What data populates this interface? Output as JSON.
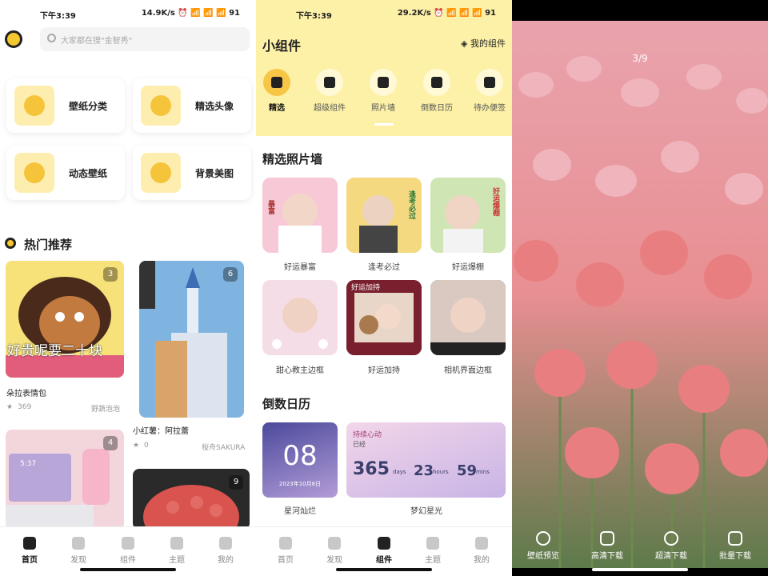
{
  "screen1": {
    "status": {
      "time": "下午3:39",
      "net": "14.9K/s ⏰ 📶 📶 📶 91"
    },
    "search_placeholder": "大家都在搜\"金智秀\"",
    "categories": [
      {
        "label": "壁纸分类"
      },
      {
        "label": "精选头像"
      },
      {
        "label": "动态壁纸"
      },
      {
        "label": "背景美图"
      }
    ],
    "section_title": "热门推荐",
    "cards": [
      {
        "count": "3",
        "overlay_text": "好贵呢要二十块",
        "title": "朵拉表情包",
        "likes": "369",
        "author": "野蔬泡泡"
      },
      {
        "count": "6",
        "title": "小红薯：阿拉蕾",
        "likes": "0",
        "author": "桜舟SAKURA"
      },
      {
        "count": "4",
        "clock": "5:37"
      },
      {
        "count": "9"
      }
    ],
    "nav": [
      "首页",
      "发现",
      "组件",
      "主题",
      "我的"
    ]
  },
  "screen2": {
    "status": {
      "time": "下午3:39",
      "net": "29.2K/s ⏰ 📶 📶 📶 91"
    },
    "title": "小组件",
    "my_widgets": "我的组件",
    "tabs": [
      {
        "label": "精选"
      },
      {
        "label": "超级组件"
      },
      {
        "label": "照片墙"
      },
      {
        "label": "倒数日历"
      },
      {
        "label": "待办便签"
      }
    ],
    "photo_wall_title": "精选照片墙",
    "photo_walls": [
      {
        "label": "好运暴富",
        "tag": "暴富"
      },
      {
        "label": "逢考必过",
        "tag": "逢考必过"
      },
      {
        "label": "好运爆棚",
        "tag": "好运爆棚"
      },
      {
        "label": "甜心教主边框"
      },
      {
        "label": "好运加持",
        "tag": "好运加持"
      },
      {
        "label": "相机界面边框"
      }
    ],
    "countdown_title": "倒数日历",
    "countdowns": [
      {
        "label": "星河灿烂",
        "big": "08",
        "date": "2023年10月8日"
      },
      {
        "label": "梦幻星光",
        "heading": "持续心动",
        "sub": "已经",
        "days": "365",
        "days_unit": "days",
        "hours": "23",
        "hours_unit": "hours",
        "mins": "59",
        "mins_unit": "mins"
      }
    ],
    "nav": [
      "首页",
      "发现",
      "组件",
      "主题",
      "我的"
    ]
  },
  "screen3": {
    "counter": "3/9",
    "actions": [
      "壁纸预览",
      "高清下载",
      "超清下载",
      "批量下载"
    ]
  }
}
